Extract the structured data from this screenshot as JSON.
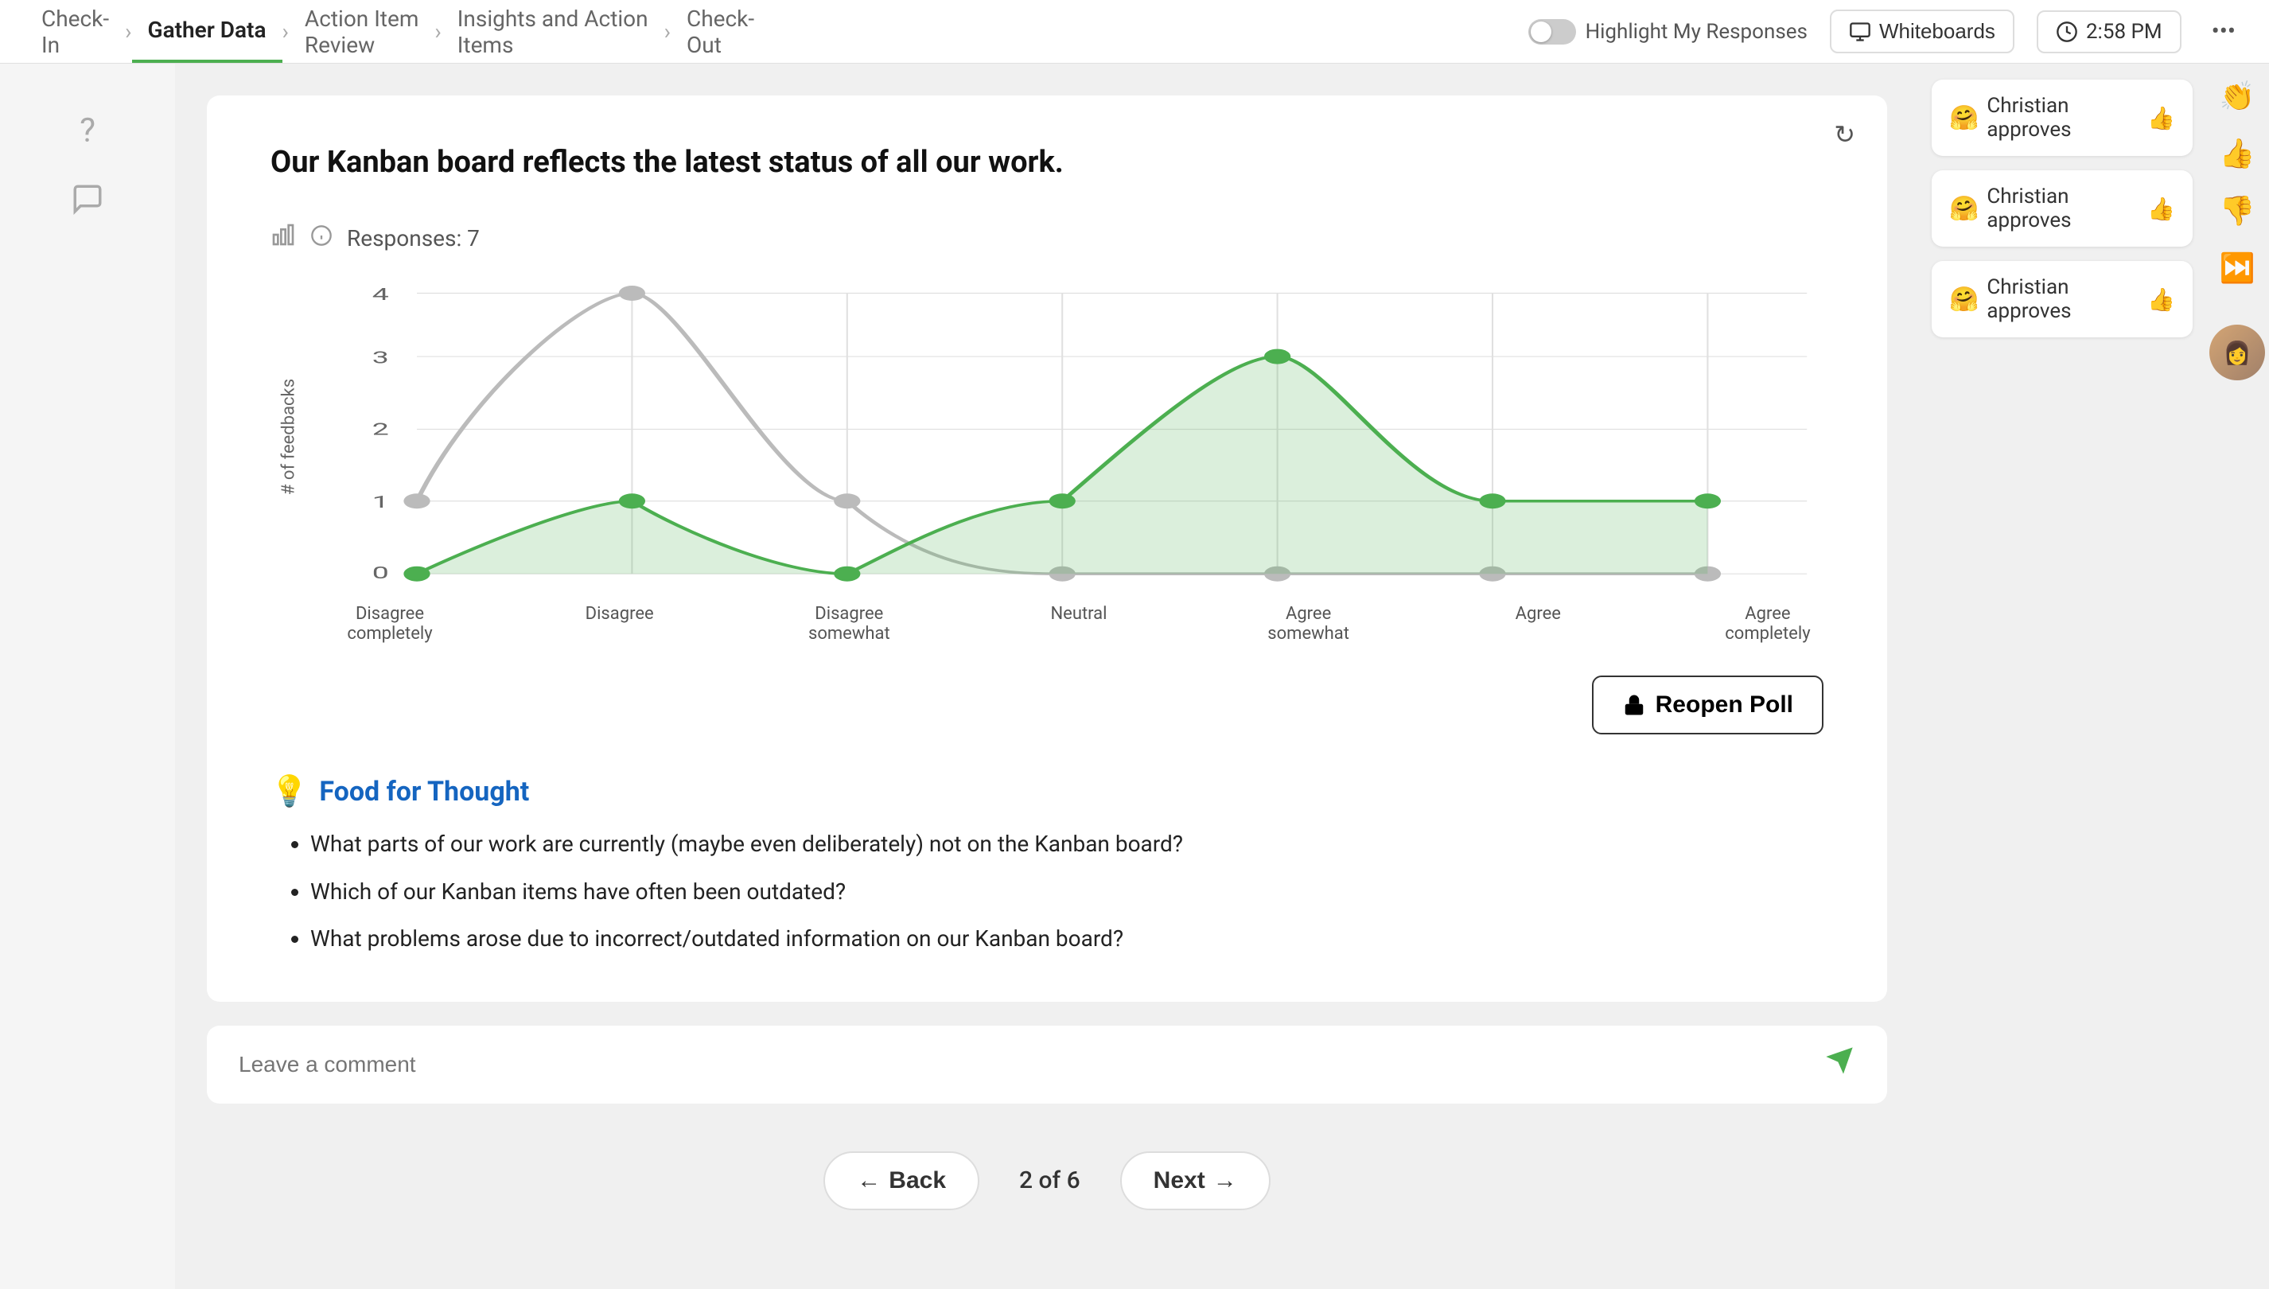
{
  "nav": {
    "steps": [
      {
        "label": "Check-\nIn",
        "active": false,
        "inactive": true
      },
      {
        "label": "Gather\nData",
        "active": true,
        "inactive": false
      },
      {
        "label": "Action Item\nReview",
        "active": false,
        "inactive": true
      },
      {
        "label": "Insights and Action\nItems",
        "active": false,
        "inactive": true
      },
      {
        "label": "Check-\nOut",
        "active": false,
        "inactive": true
      }
    ],
    "highlight_label": "Highlight My Responses",
    "whiteboards_label": "Whiteboards",
    "time_label": "2:58 PM",
    "more_icon": "•••"
  },
  "card": {
    "question": "Our Kanban board reflects the latest status of all our work.",
    "responses_label": "Responses: 7",
    "refresh_icon": "↻",
    "chart": {
      "y_label": "# of feedbacks",
      "y_max": 4,
      "x_labels": [
        "Disagree completely",
        "Disagree",
        "Disagree somewhat",
        "Neutral",
        "Agree somewhat",
        "Agree",
        "Agree completely"
      ],
      "green_data": [
        0,
        1,
        0,
        1,
        3,
        1,
        1
      ],
      "gray_data": [
        1,
        4,
        1,
        0,
        0,
        0,
        0
      ]
    },
    "reopen_btn_label": "Reopen Poll",
    "food": {
      "icon": "💡",
      "title": "Food for Thought",
      "items": [
        "What parts of our work are currently (maybe even deliberately) not on the Kanban board?",
        "Which of our Kanban items have often been outdated?",
        "What problems arose due to incorrect/outdated information on our Kanban board?"
      ]
    }
  },
  "comment": {
    "placeholder": "Leave a comment"
  },
  "pagination": {
    "back_label": "Back",
    "page_info": "2 of 6",
    "next_label": "Next"
  },
  "reactions": [
    {
      "emoji": "🤗",
      "text": "Christian approves",
      "icon": "👍"
    },
    {
      "emoji": "🤗",
      "text": "Christian approves",
      "icon": "👍"
    },
    {
      "emoji": "🤗",
      "text": "Christian approves",
      "icon": "👍"
    }
  ],
  "side_icons": [
    "👏",
    "👍",
    "👎",
    "⏭️"
  ]
}
